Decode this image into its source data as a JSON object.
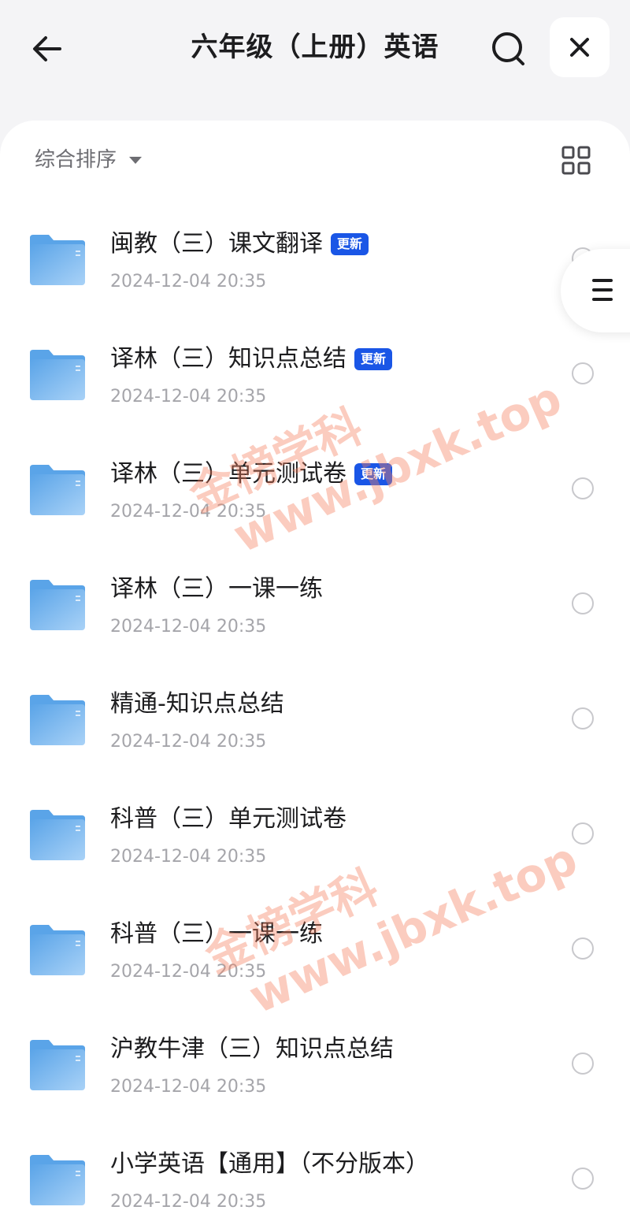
{
  "header": {
    "title": "六年级（上册）英语",
    "back_icon": "arrow-left-icon",
    "search_icon": "search-icon",
    "close_icon": "close-icon"
  },
  "toolbar": {
    "sort_label": "综合排序",
    "sort_icon": "caret-down-icon",
    "view_icon": "grid-view-icon"
  },
  "files": [
    {
      "name": "闽教（三）课文翻译",
      "date": "2024-12-04 20:35",
      "badge": "更新"
    },
    {
      "name": "译林（三）知识点总结",
      "date": "2024-12-04 20:35",
      "badge": "更新"
    },
    {
      "name": "译林（三）单元测试卷",
      "date": "2024-12-04 20:35",
      "badge": "更新"
    },
    {
      "name": "译林（三）一课一练",
      "date": "2024-12-04 20:35",
      "badge": ""
    },
    {
      "name": "精通-知识点总结",
      "date": "2024-12-04 20:35",
      "badge": ""
    },
    {
      "name": "科普（三）单元测试卷",
      "date": "2024-12-04 20:35",
      "badge": ""
    },
    {
      "name": "科普（三）一课一练",
      "date": "2024-12-04 20:35",
      "badge": ""
    },
    {
      "name": "沪教牛津（三）知识点总结",
      "date": "2024-12-04 20:35",
      "badge": ""
    },
    {
      "name": "小学英语【通用】（不分版本）",
      "date": "2024-12-04 20:35",
      "badge": ""
    }
  ],
  "side_menu_icon": "menu-icon",
  "watermarks": [
    {
      "line1": "金榜学科",
      "line2": "www.jbxk.top"
    },
    {
      "line1": "金榜学科",
      "line2": "www.jbxk.top"
    }
  ],
  "colors": {
    "badge": "#1a56e6",
    "folder_top": "#5aa4e8",
    "folder_bottom": "#a9d2f7",
    "watermark": "#f48060"
  }
}
